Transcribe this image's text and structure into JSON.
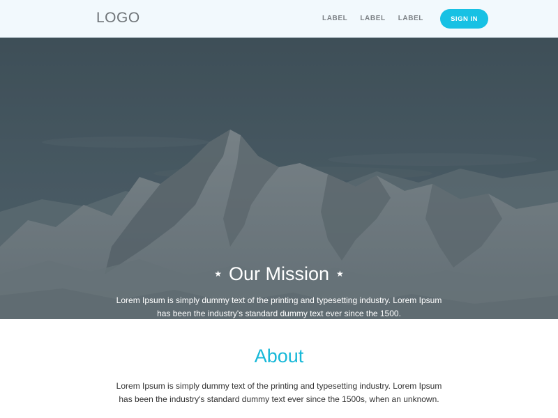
{
  "header": {
    "logo": "LOGO",
    "nav": [
      {
        "label": "LABEL"
      },
      {
        "label": "LABEL"
      },
      {
        "label": "LABEL"
      }
    ],
    "signin_label": "SIGN IN"
  },
  "hero": {
    "title": "Our Mission",
    "text": "Lorem Ipsum is simply dummy text of the printing and typesetting industry. Lorem Ipsum has been the industry's standard dummy text ever since the 1500."
  },
  "about": {
    "title": "About",
    "text": "Lorem Ipsum is simply dummy text of the printing and typesetting industry. Lorem Ipsum has been the industry's standard dummy text ever since the 1500s, when an unknown."
  },
  "colors": {
    "accent": "#17c1e4",
    "header_bg": "#f2f9fd",
    "hero_overlay": "#4a5a64"
  }
}
